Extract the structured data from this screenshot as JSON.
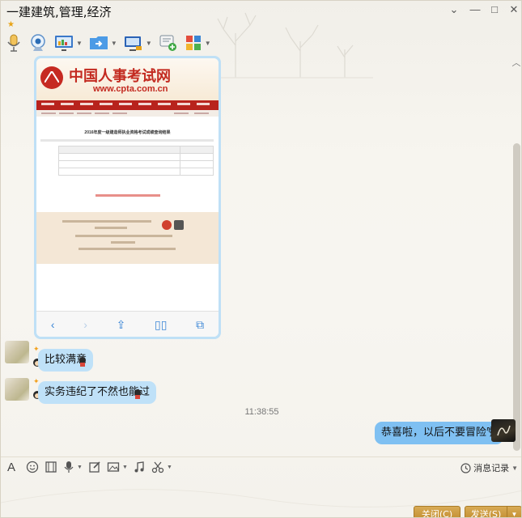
{
  "window": {
    "title": "一建建筑,管理,经济",
    "controls": {
      "menu": "⌄",
      "minimize": "—",
      "maximize": "□",
      "close": "✕"
    }
  },
  "toolbar": {
    "items": [
      {
        "name": "voice-call-icon"
      },
      {
        "name": "video-call-icon"
      },
      {
        "name": "remote-desktop-icon"
      },
      {
        "name": "file-transfer-icon"
      },
      {
        "name": "screen-share-icon"
      },
      {
        "name": "create-group-icon"
      },
      {
        "name": "apps-icon"
      }
    ]
  },
  "colors": {
    "bubble_other": "#bfe1f8",
    "bubble_me": "#7fc0f2",
    "button": "#c8922f",
    "shot_red": "#c32a20"
  },
  "screenshot": {
    "site_title": "中国人事考试网",
    "site_url": "www.cpta.com.cn",
    "doc_title": "2016年度一级建造师执业资格考试成绩查询结果"
  },
  "messages": [
    {
      "text": "比较满意"
    },
    {
      "text": "实务违纪了不然也能过"
    },
    {
      "text": "恭喜啦，以后不要冒险啦"
    }
  ],
  "timestamp": "11:38:55",
  "input_toolbar": {
    "history_label": "消息记录"
  },
  "buttons": {
    "close": "关闭(C)",
    "send": "发送(S)"
  }
}
